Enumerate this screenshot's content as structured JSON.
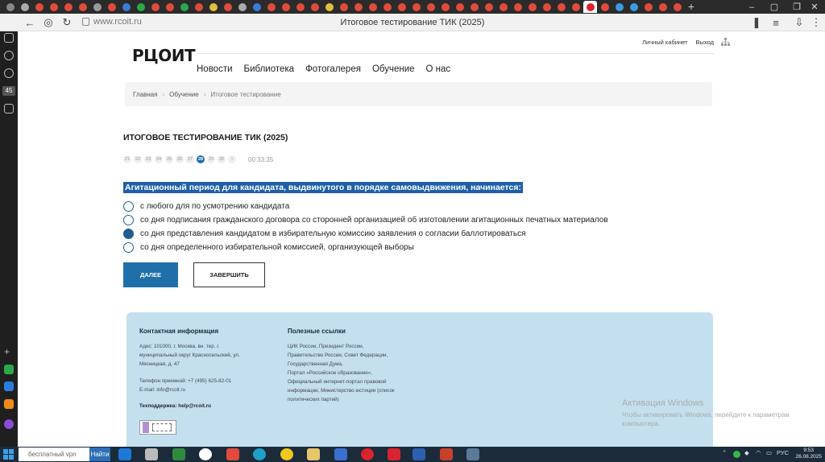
{
  "browser": {
    "url": "www.rcoit.ru",
    "page_title": "Итоговое тестирование ТИК (2025)",
    "sidepanel_badge": "45"
  },
  "site": {
    "logo_text": "РЦОИТ",
    "top_links": [
      "Личный кабинет",
      "Выход"
    ],
    "nav": [
      "Новости",
      "Библиотека",
      "Фотогалерея",
      "Обучение",
      "О нас"
    ],
    "breadcrumbs": [
      "Главная",
      "Обучение",
      "Итоговое тестирование"
    ],
    "breadcrumb_sep": "›"
  },
  "test": {
    "title": "ИТОГОВОЕ ТЕСТИРОВАНИЕ ТИК (2025)",
    "question_numbers": [
      "21",
      "22",
      "23",
      "24",
      "25",
      "26",
      "27",
      "28",
      "29",
      "30",
      "›"
    ],
    "current_question": "28",
    "timer": "00:33:35",
    "question": "Агитационный период для кандидата, выдвинутого в порядке самовыдвижения, начинается:",
    "answers": [
      {
        "text": "с любого для по усмотрению кандидата",
        "checked": false
      },
      {
        "text": "со дня подписания гражданского договора со сторонней организацией об изготовлении агитационных печатных материалов",
        "checked": false
      },
      {
        "text": "со дня представления кандидатом в избирательную комиссию заявления о согласии баллотироваться",
        "checked": true
      },
      {
        "text": "со дня определенного избирательной комиссией, организующей выборы",
        "checked": false
      }
    ],
    "next_label": "ДАЛЕЕ",
    "finish_label": "ЗАВЕРШИТЬ"
  },
  "footer": {
    "contact_heading": "Контактная информация",
    "address": [
      "Адес:  101000, г. Москва, вн. тер. г.",
      "муниципальный округ Красносельский, ул.",
      "Мясницкая, д. 47"
    ],
    "phone": "Телефон приемной:  +7 (495) 625-82-01",
    "email": "E-mail:  info@rcoit.ru",
    "support": "Техподдержка:  help@rcoit.ru",
    "links_heading": "Полезные ссылки",
    "links": [
      "ЦИК России, Президент России,",
      "Правительство России, Совет Федерации,",
      "Государственная Дума,",
      "Портал «Российское образование»,",
      "Официальный интернет-портал правовой",
      "информации, Министерство юстиции (список",
      "политических партий)"
    ]
  },
  "activation": {
    "title": "Активация Windows",
    "text": "Чтобы активировать Windows, перейдите к параметрам компьютера."
  },
  "taskbar": {
    "search_placeholder": "бесплатный vpn",
    "search_button": "Найти",
    "lang": "РУС",
    "time": "9:53",
    "date": "26.08.2025"
  },
  "colors": {
    "accent": "#1f6fa8",
    "footer_bg": "#c4e0ee",
    "logo_check": "#d9232e"
  }
}
